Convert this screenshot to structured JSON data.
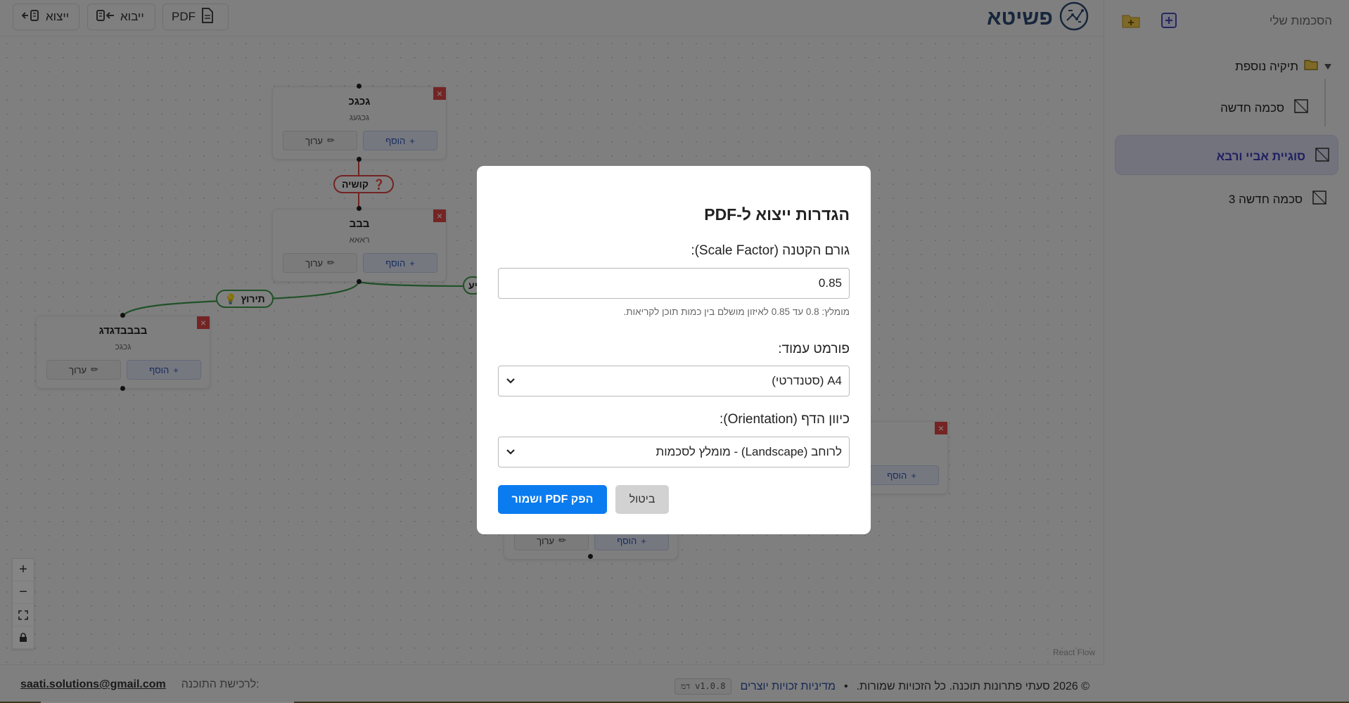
{
  "sidebar": {
    "title": "הסכמות שלי",
    "folder": {
      "label": "תיקיה נוספת",
      "items": [
        {
          "label": "סכמה חדשה"
        }
      ]
    },
    "items": [
      {
        "label": "סוגיית אביי ורבא",
        "active": true
      },
      {
        "label": "סכמה חדשה 3"
      }
    ]
  },
  "toolbar": {
    "export_label": "ייצוא",
    "import_label": "ייבוא",
    "pdf_label": "PDF"
  },
  "logo": {
    "text": "פשיטא"
  },
  "canvas": {
    "nodes": [
      {
        "title": "גכגכ",
        "subtitle": "גכגעג",
        "add_label": "הוסף",
        "edit_label": "ערוך"
      },
      {
        "title": "בבב",
        "subtitle": "ראאא",
        "add_label": "הוסף",
        "edit_label": "ערוך"
      },
      {
        "title": "בבבבדגדג",
        "subtitle": "גכגכ",
        "add_label": "הוסף",
        "edit_label": "ערוך"
      },
      {
        "title": "",
        "subtitle": "",
        "add_label": "הוסף",
        "edit_label": ""
      },
      {
        "title": "",
        "subtitle": "",
        "add_label": "הוסף",
        "edit_label": "ערוך"
      }
    ],
    "edge_labels": {
      "question": "קושיה",
      "answer": "תירוץ",
      "partial": "יע"
    },
    "attribution": "React Flow"
  },
  "footer": {
    "copyright": "© 2026 סעתי פתרונות תוכנה. כל הזכויות שמורות.",
    "separator": "•",
    "policy_link": "מדיניות זכויות יוצרים",
    "version": "v1.0.8",
    "version_tag": "דמ",
    "purchase_text": "לרכישת התוכנה:",
    "email": "saati.solutions@gmail.com"
  },
  "modal": {
    "title": "הגדרות ייצוא ל-PDF",
    "scale_label": "גורם הקטנה (Scale Factor):",
    "scale_value": "0.85",
    "scale_hint": "מומלץ: 0.8 עד 0.85 לאיזון מושלם בין כמות תוכן לקריאות.",
    "format_label": "פורמט עמוד:",
    "format_value": "A4 (סטנדרטי)",
    "orientation_label": "כיוון הדף (Orientation):",
    "orientation_value": "לרוחב (Landscape) - מומלץ לסכמות",
    "submit_label": "הפק PDF ושמור",
    "cancel_label": "ביטול"
  },
  "colors": {
    "primary": "#0b7bf0",
    "active_item": "#3d3dbb",
    "logo": "#2d4a73",
    "question_edge": "#dd4444",
    "answer_edge": "#3c9b4c",
    "delete": "#e04545"
  }
}
